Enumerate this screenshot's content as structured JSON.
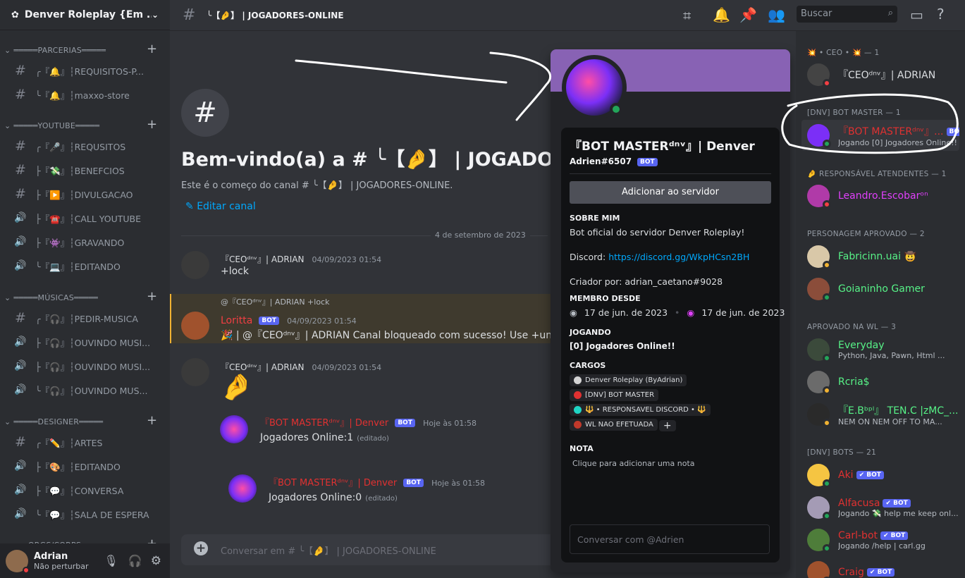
{
  "server": {
    "name": "Denver Roleplay {Em ..."
  },
  "categories": [
    {
      "name": "═════PARCERIAS═════",
      "channels": [
        {
          "icon": "#",
          "label": "╭『🔔』┆REQUISITOS-P..."
        },
        {
          "icon": "#",
          "label": "╰『🔔』┆maxxo-store"
        }
      ]
    },
    {
      "name": "═════YOUTUBE═════",
      "channels": [
        {
          "icon": "#",
          "label": "╭『🎤』┆REQUSITOS"
        },
        {
          "icon": "#",
          "label": "├『💸』┆BENEFCIOS"
        },
        {
          "icon": "#",
          "label": "├『▶️』┆DIVULGACAO"
        },
        {
          "icon": "🔊",
          "label": "├『☎️』┆CALL YOUTUBE"
        },
        {
          "icon": "🔊",
          "label": "├『👾』┆GRAVANDO"
        },
        {
          "icon": "🔊",
          "label": "╰『💻』┆EDITANDO"
        }
      ]
    },
    {
      "name": "═════MÚSICAS═════",
      "channels": [
        {
          "icon": "#",
          "label": "╭『🎧』┆PEDIR-MUSICA"
        },
        {
          "icon": "🔊",
          "label": "├『🎧』┆OUVINDO MUSI..."
        },
        {
          "icon": "🔊",
          "label": "├『🎧』┆OUVINDO MUSI..."
        },
        {
          "icon": "🔊",
          "label": "╰『🎧』┆OUVINDO MUS..."
        }
      ]
    },
    {
      "name": "═════DESIGNER═════",
      "channels": [
        {
          "icon": "#",
          "label": "╭『✏️』┆ARTES"
        },
        {
          "icon": "🔊",
          "label": "├『🎨』┆EDITANDO"
        },
        {
          "icon": "🔊",
          "label": "├『💬』┆CONVERSA"
        },
        {
          "icon": "🔊",
          "label": "╰『💬』┆SALA DE ESPERA"
        }
      ]
    },
    {
      "name": "═══ORGS/CORPS═══",
      "channels": []
    }
  ],
  "user": {
    "name": "Adrian",
    "status": "Não perturbar"
  },
  "topbar": {
    "channel": "╰【🤌】 | JOGADORES-ONLINE",
    "search_placeholder": "Buscar"
  },
  "welcome": {
    "title": "Bem-vindo(a) a # ╰【🤌】 | JOGADORES-ONLINE",
    "subtitle": "Este é o começo do canal # ╰【🤌】 | JOGADORES-ONLINE.",
    "edit": "Editar canal"
  },
  "date_divider": "4 de setembro de 2023",
  "messages": [
    {
      "author": "『CEOᵈⁿᵛ』| ADRIAN",
      "time": "04/09/2023 01:54",
      "text": "+lock"
    },
    {
      "reply_to": "@『CEOᵈⁿᵛ』| ADRIAN +lock",
      "author": "Loritta",
      "badge": "BOT",
      "time": "04/09/2023 01:54",
      "text": "🎉 | @『CEOᵈⁿᵛ』| ADRIAN Canal bloqueado com sucesso! Use +unlock"
    },
    {
      "author": "『CEOᵈⁿᵛ』| ADRIAN",
      "time": "04/09/2023 01:54",
      "text": "🤌"
    },
    {
      "author": "『BOT MASTERᵈⁿᵛ』| Denver",
      "badge": "BOT",
      "time": "Hoje às 01:58",
      "text": "Jogadores Online:1",
      "edited": "(editado)"
    },
    {
      "author": "『BOT MASTERᵈⁿᵛ』| Denver",
      "badge": "BOT",
      "time": "Hoje às 01:58",
      "text": "Jogadores Online:0",
      "edited": "(editado)"
    }
  ],
  "composer": {
    "placeholder": "Conversar em # ╰【🤌】 | JOGADORES-ONLINE"
  },
  "profile": {
    "display_name": "『BOT MASTERᵈⁿᵛ』| Denver",
    "tag": "Adrien#6507",
    "badge": "BOT",
    "add_button": "Adicionar ao servidor",
    "about_title": "SOBRE MIM",
    "about_line1": "Bot oficial do servidor Denver Roleplay!",
    "about_discord_label": "Discord:",
    "about_discord_link": "https://discord.gg/WkpHCsn2BH",
    "about_creator": "Criador por: adrian_caetano#9028",
    "member_since_title": "MEMBRO DESDE",
    "member_since_discord": "17 de jun. de 2023",
    "member_since_server": "17 de jun. de 2023",
    "playing_title": "JOGANDO",
    "playing": "[0] Jogadores Online!!",
    "roles_title": "CARGOS",
    "roles": [
      {
        "name": "Denver Roleplay (ByAdrian)",
        "color": "#d4d4d4"
      },
      {
        "name": "[DNV] BOT MASTER",
        "color": "#e03131"
      },
      {
        "name": "🔱 • RESPONSAVEL DISCORD • 🔱",
        "color": "#1fd5c4"
      },
      {
        "name": "WL NAO EFETUADA",
        "color": "#c0392b"
      }
    ],
    "note_title": "NOTA",
    "note_placeholder": "Clique para adicionar uma nota",
    "message_placeholder": "Conversar com @Adrien"
  },
  "members": {
    "groups": [
      {
        "title": "💥 • CEO • 💥 — 1",
        "members": [
          {
            "name": "『CEOᵈⁿᵛ』| ADRIAN",
            "color": "#dbdee1",
            "sub": "",
            "status": "dn"
          }
        ]
      },
      {
        "title": "[DNV] BOT MASTER — 1",
        "members": [
          {
            "name": "『BOT MASTERᵈⁿᵛ』...",
            "color": "#e03131",
            "sub": "Jogando [0] Jogadores Online!!",
            "status": "on",
            "bot": "BOT"
          }
        ]
      },
      {
        "title": "🤌 RESPONSÁVEL ATENDENTES — 1",
        "members": [
          {
            "name": "Leandro.Escobarᵒⁿ",
            "color": "#e040fb",
            "sub": "",
            "status": "dn"
          }
        ]
      },
      {
        "title": "PERSONAGEM APROVADO — 2",
        "members": [
          {
            "name": "Fabricinn.uai 🤠",
            "color": "#57f287",
            "sub": "",
            "status": "idle"
          },
          {
            "name": "Goianinho Gamer",
            "color": "#57f287",
            "sub": "",
            "status": "on"
          }
        ]
      },
      {
        "title": "APROVADO NA WL — 3",
        "members": [
          {
            "name": "Everyday",
            "color": "#57f287",
            "sub": "Python, Java, Pawn, Html ...",
            "status": "on"
          },
          {
            "name": "Rcria$",
            "color": "#57f287",
            "sub": "",
            "status": "idle"
          },
          {
            "name": "『E.Bᵇᵖˡ』 TEN.C |zMC_...",
            "color": "#57f287",
            "sub": "NEM ON NEM OFF TO MA...",
            "status": "idle"
          }
        ]
      },
      {
        "title": "[DNV] BOTS — 21",
        "members": [
          {
            "name": "Aki",
            "color": "#e03131",
            "sub": "",
            "status": "on",
            "bot": "✔ BOT"
          },
          {
            "name": "Alfacusa",
            "color": "#e03131",
            "sub": "Jogando 💸 help me keep onl...",
            "status": "on",
            "bot": "✔ BOT"
          },
          {
            "name": "Carl-bot",
            "color": "#e03131",
            "sub": "Jogando /help | carl.gg",
            "status": "on",
            "bot": "✔ BOT"
          },
          {
            "name": "Craig",
            "color": "#e03131",
            "sub": "",
            "status": "on",
            "bot": "✔ BOT"
          }
        ]
      }
    ]
  }
}
